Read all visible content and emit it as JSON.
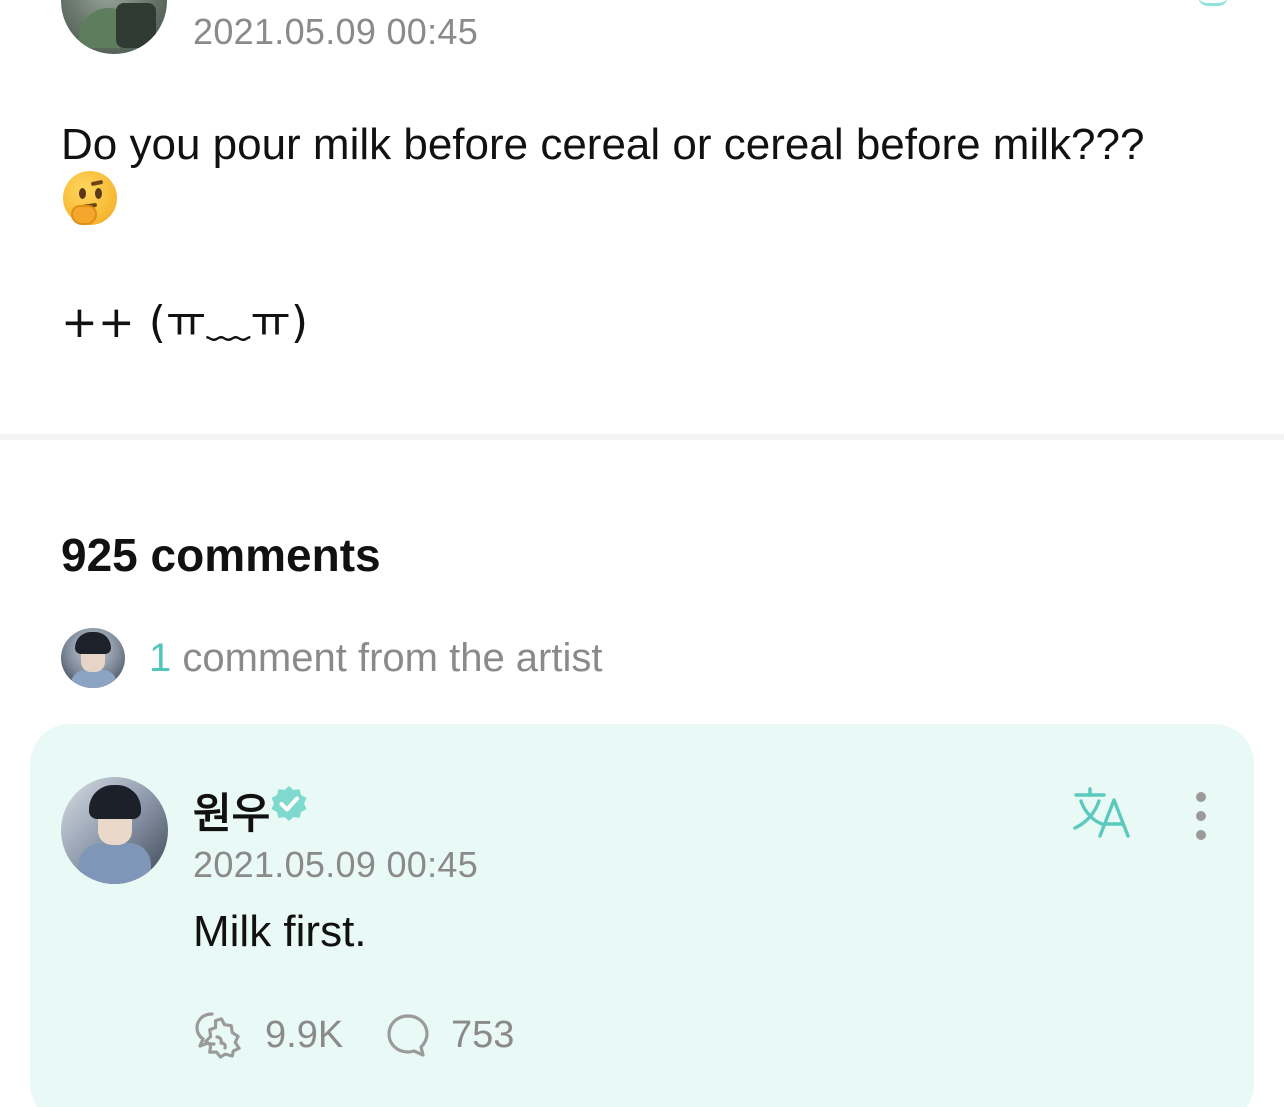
{
  "post": {
    "timestamp": "2021.05.09 00:45",
    "text": "Do you pour milk before cereal or cereal before milk???",
    "emoji_icon": "thinking-face-emoji",
    "ps_text": "++ (ㅠ﹏ㅠ)"
  },
  "comments": {
    "title": "925 comments",
    "artist_count": "1",
    "artist_label": " comment from the artist"
  },
  "artist_comment": {
    "author": "원우",
    "verified_icon": "verified-badge-icon",
    "timestamp": "2021.05.09 00:45",
    "text": "Milk first.",
    "likes": "9.9K",
    "replies": "753",
    "translate_icon": "translate-icon",
    "more_icon": "more-vertical-icon"
  },
  "colors": {
    "accent": "#4fc7ba",
    "card_background": "#e9f9f6",
    "muted_text": "#8a8a8a",
    "primary_text": "#111111"
  }
}
